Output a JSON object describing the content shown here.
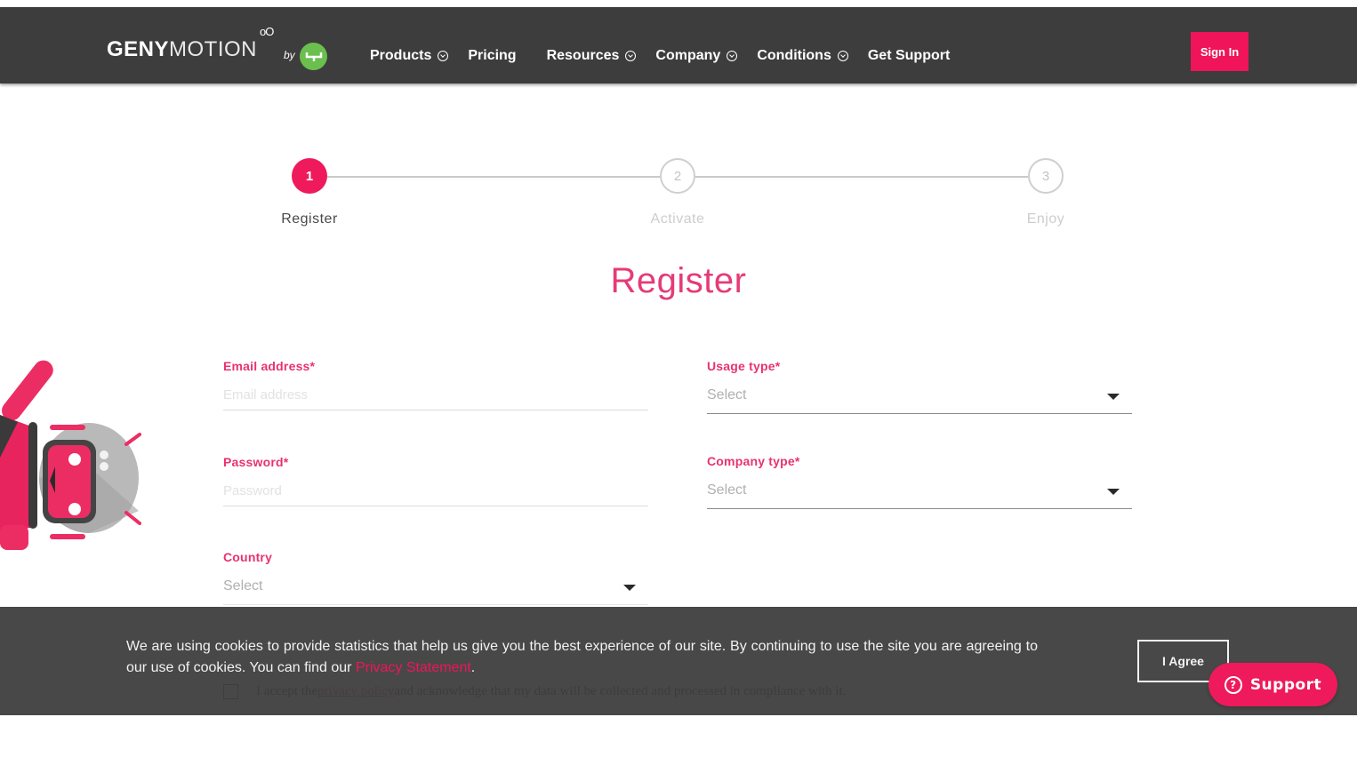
{
  "header": {
    "logo": {
      "part1": "GENY",
      "part2": "MOTION",
      "dots": "oO",
      "by": "by"
    },
    "nav": [
      {
        "label": "Products",
        "has_dropdown": true
      },
      {
        "label": "Pricing",
        "has_dropdown": false
      },
      {
        "label": "Resources",
        "has_dropdown": true
      },
      {
        "label": "Company",
        "has_dropdown": true
      },
      {
        "label": "Conditions",
        "has_dropdown": true
      },
      {
        "label": "Get Support",
        "has_dropdown": false
      }
    ],
    "sign_in": "Sign In"
  },
  "stepper": {
    "current_step": 1,
    "steps": [
      {
        "number": "1",
        "label": "Register"
      },
      {
        "number": "2",
        "label": "Activate"
      },
      {
        "number": "3",
        "label": "Enjoy"
      }
    ]
  },
  "page": {
    "title": "Register"
  },
  "form": {
    "email": {
      "label": "Email address*",
      "placeholder": "Email address",
      "value": ""
    },
    "password": {
      "label": "Password*",
      "placeholder": "Password",
      "value": ""
    },
    "country": {
      "label": "Country",
      "value": "Select"
    },
    "usage_type": {
      "label": "Usage type*",
      "value": "Select"
    },
    "company_type": {
      "label": "Company type*",
      "value": "Select"
    },
    "consent": {
      "prefix": "I accept the ",
      "link": "privacy policy",
      "suffix": " and acknowledge that my data will be collected and processed in compliance with it."
    }
  },
  "cookie_bar": {
    "text_main": "We are using cookies to provide statistics that help us give you the best experience of our site. By continuing to use the site you are agreeing to our use of cookies. You can find our ",
    "link": "Privacy Statement",
    "text_end": ".",
    "agree": "I Agree"
  },
  "support": {
    "label": "Support",
    "icon": "?"
  },
  "colors": {
    "accent": "#ee1a5b",
    "label": "#e8336f",
    "header_bg": "#3d3d3d",
    "logo_badge": "#6bbf4e"
  }
}
